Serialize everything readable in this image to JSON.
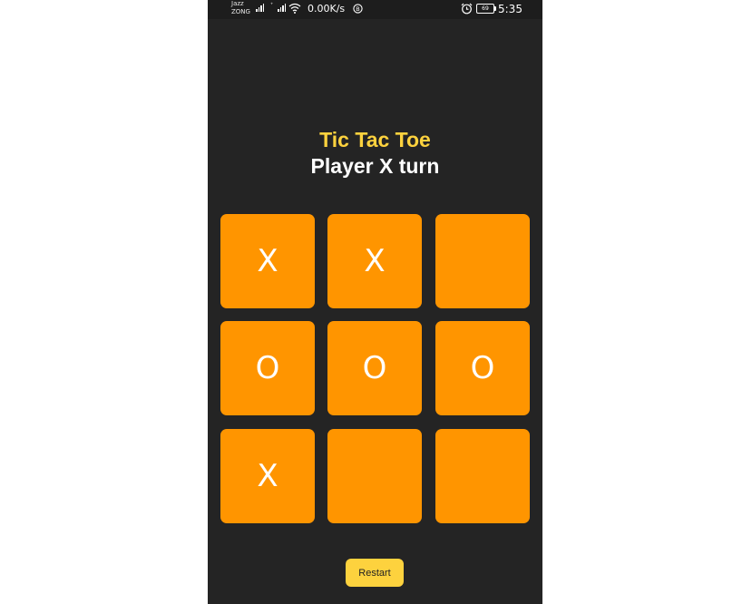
{
  "status_bar": {
    "carrier_top": "Jazz",
    "carrier_bottom": "ZONG",
    "net_tag_1": "⁺",
    "net_tag_2": "4G",
    "speed": "0.00K/s",
    "battery": "69",
    "time": "5:35"
  },
  "game": {
    "title": "Tic Tac Toe",
    "turn_text": "Player X turn",
    "board": [
      "X",
      "X",
      "",
      "O",
      "O",
      "O",
      "X",
      "",
      ""
    ],
    "restart_label": "Restart"
  },
  "colors": {
    "background": "#242424",
    "cell": "#ff9500",
    "accent": "#fdd23e",
    "mark": "#ffffff"
  }
}
